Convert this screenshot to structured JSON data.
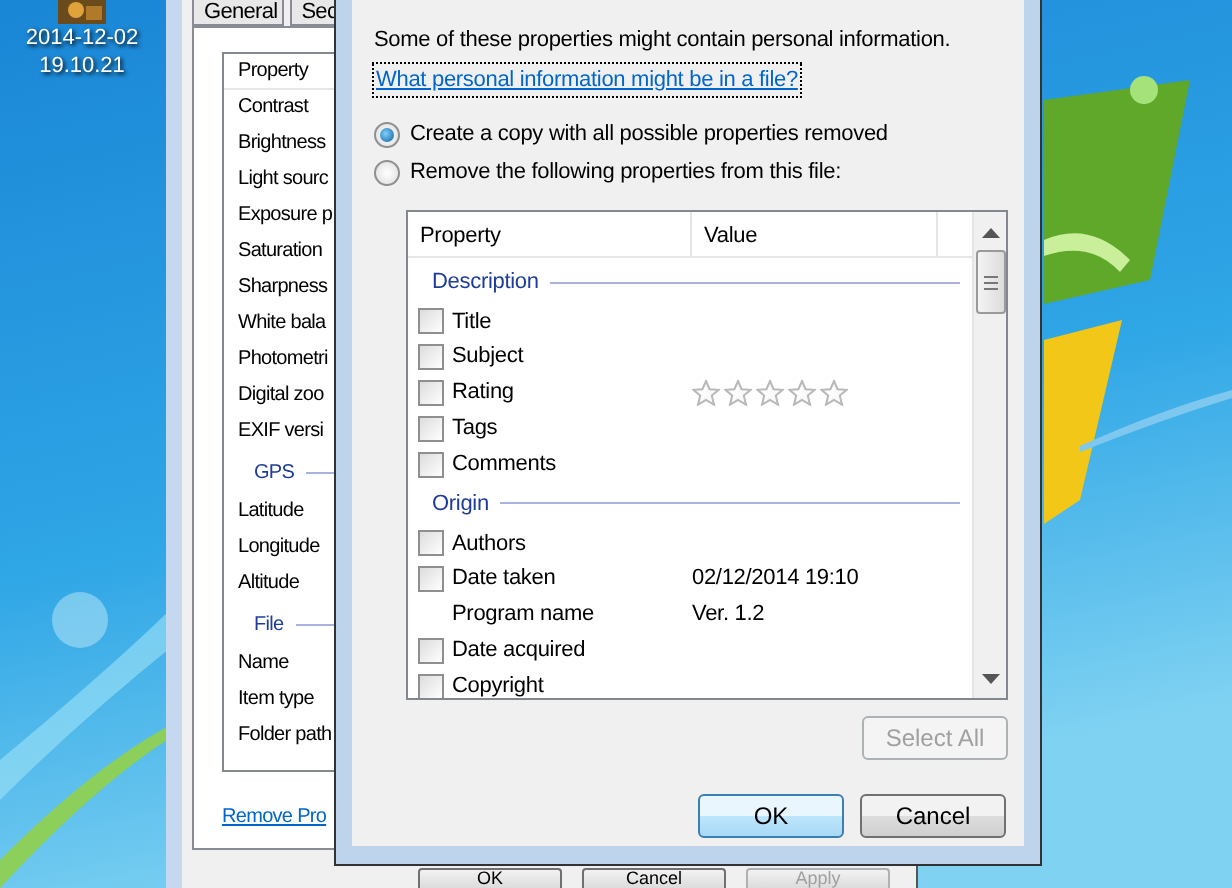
{
  "desktop": {
    "icon": {
      "label_lines": [
        "2014-12-02",
        "19.10.21"
      ]
    }
  },
  "properties_window": {
    "tabs": [
      {
        "label": "General",
        "selected": false
      },
      {
        "label": "Sec",
        "selected": false
      }
    ],
    "list": {
      "column": "Property",
      "items": [
        {
          "kind": "row",
          "label": "Contrast"
        },
        {
          "kind": "row",
          "label": "Brightness"
        },
        {
          "kind": "row",
          "label": "Light sourc"
        },
        {
          "kind": "row",
          "label": "Exposure p"
        },
        {
          "kind": "row",
          "label": "Saturation"
        },
        {
          "kind": "row",
          "label": "Sharpness"
        },
        {
          "kind": "row",
          "label": "White bala"
        },
        {
          "kind": "row",
          "label": "Photometri"
        },
        {
          "kind": "row",
          "label": "Digital zoo"
        },
        {
          "kind": "row",
          "label": "EXIF versi"
        },
        {
          "kind": "group",
          "label": "GPS"
        },
        {
          "kind": "row",
          "label": "Latitude"
        },
        {
          "kind": "row",
          "label": "Longitude"
        },
        {
          "kind": "row",
          "label": "Altitude"
        },
        {
          "kind": "group",
          "label": "File"
        },
        {
          "kind": "row",
          "label": "Name"
        },
        {
          "kind": "row",
          "label": "Item type"
        },
        {
          "kind": "row",
          "label": "Folder path"
        }
      ]
    },
    "link": "Remove Pro",
    "buttons": [
      {
        "label": "OK",
        "disabled": false
      },
      {
        "label": "Cancel",
        "disabled": false
      },
      {
        "label": "Apply",
        "disabled": true
      }
    ]
  },
  "remove_dialog": {
    "intro": "Some of these properties might contain personal information.",
    "link": {
      "label": "What personal information might be in a file?",
      "focused": true
    },
    "options": [
      {
        "label": "Create a copy with all possible properties removed",
        "selected": true
      },
      {
        "label": "Remove the following properties from this file:",
        "selected": false
      }
    ],
    "table": {
      "columns": [
        "Property",
        "Value"
      ],
      "items": [
        {
          "kind": "group",
          "label": "Description"
        },
        {
          "kind": "checkbox",
          "label": "Title",
          "checked": false
        },
        {
          "kind": "checkbox",
          "label": "Subject",
          "checked": false
        },
        {
          "kind": "checkbox",
          "label": "Rating",
          "checked": false,
          "stars": 0
        },
        {
          "kind": "checkbox",
          "label": "Tags",
          "checked": false
        },
        {
          "kind": "checkbox",
          "label": "Comments",
          "checked": false
        },
        {
          "kind": "group",
          "label": "Origin"
        },
        {
          "kind": "checkbox",
          "label": "Authors",
          "checked": false
        },
        {
          "kind": "checkbox",
          "label": "Date taken",
          "checked": false,
          "value": "02/12/2014 19:10"
        },
        {
          "kind": "plain",
          "label": "Program name",
          "value": "Ver. 1.2"
        },
        {
          "kind": "checkbox",
          "label": "Date acquired",
          "checked": false
        },
        {
          "kind": "checkbox",
          "label": "Copyright",
          "checked": false
        }
      ]
    },
    "select_all": {
      "label": "Select All",
      "disabled": true
    },
    "buttons": [
      {
        "label": "OK",
        "default": true
      },
      {
        "label": "Cancel",
        "default": false
      }
    ]
  }
}
